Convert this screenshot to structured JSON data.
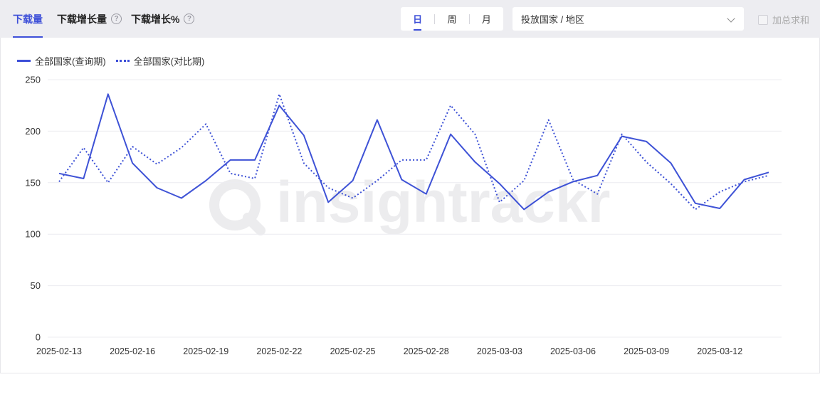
{
  "tabs": {
    "downloads": "下载量",
    "download_growth": "下载增长量",
    "download_growth_pct": "下载增长%",
    "help_glyph": "?"
  },
  "period": {
    "day": "日",
    "week": "周",
    "month": "月",
    "selected": "日"
  },
  "region_select": {
    "value": "投放国家 / 地区"
  },
  "sum_checkbox": {
    "label": "加总求和",
    "checked": false
  },
  "watermark": "insightrackr",
  "colors": {
    "accent": "#3d4fd8",
    "series": "#3e52d6",
    "grid": "#ececf0"
  },
  "chart_data": {
    "type": "line",
    "ylim": [
      0,
      250
    ],
    "yticks": [
      0,
      50,
      100,
      150,
      200,
      250
    ],
    "grid": "horizontal",
    "legend_placement": "top-left",
    "x": [
      "2025-02-13",
      "2025-02-14",
      "2025-02-15",
      "2025-02-16",
      "2025-02-17",
      "2025-02-18",
      "2025-02-19",
      "2025-02-20",
      "2025-02-21",
      "2025-02-22",
      "2025-02-23",
      "2025-02-24",
      "2025-02-25",
      "2025-02-26",
      "2025-02-27",
      "2025-02-28",
      "2025-03-01",
      "2025-03-02",
      "2025-03-03",
      "2025-03-04",
      "2025-03-05",
      "2025-03-06",
      "2025-03-07",
      "2025-03-08",
      "2025-03-09",
      "2025-03-10",
      "2025-03-11",
      "2025-03-12",
      "2025-03-13",
      "2025-03-14"
    ],
    "xtick_labels": [
      "2025-02-13",
      "2025-02-16",
      "2025-02-19",
      "2025-02-22",
      "2025-02-25",
      "2025-02-28",
      "2025-03-03",
      "2025-03-06",
      "2025-03-09",
      "2025-03-12"
    ],
    "series": [
      {
        "name": "全部国家(查询期)",
        "style": "solid",
        "values": [
          159,
          154,
          236,
          169,
          145,
          135,
          152,
          172,
          172,
          225,
          196,
          131,
          152,
          211,
          153,
          139,
          197,
          170,
          149,
          124,
          141,
          151,
          157,
          195,
          190,
          169,
          130,
          125,
          153,
          160
        ]
      },
      {
        "name": "全部国家(对比期)",
        "style": "dotted",
        "values": [
          151,
          184,
          150,
          185,
          168,
          184,
          207,
          159,
          154,
          236,
          169,
          145,
          135,
          152,
          172,
          172,
          225,
          197,
          131,
          152,
          211,
          153,
          139,
          197,
          170,
          149,
          124,
          141,
          151,
          157
        ]
      }
    ]
  }
}
